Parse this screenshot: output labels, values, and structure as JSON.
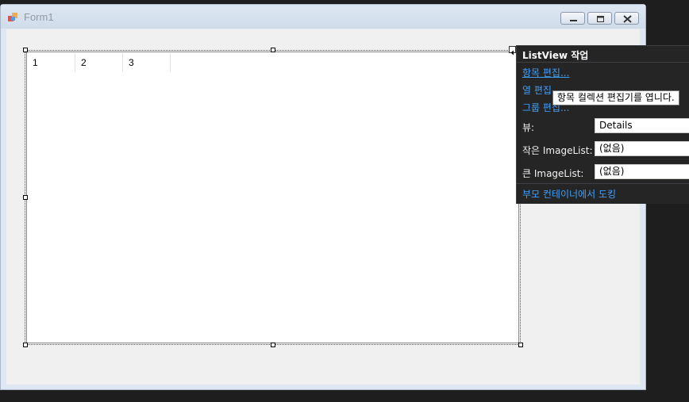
{
  "form": {
    "title": "Form1",
    "caption_buttons": [
      "minimize-icon",
      "maximize-icon",
      "close-icon"
    ]
  },
  "listview": {
    "columns": [
      "1",
      "2",
      "3"
    ]
  },
  "smart_tag": {
    "title": "ListView 작업",
    "links": {
      "edit_items": "항목 편집...",
      "edit_columns": "열 편집...",
      "edit_groups": "그룹 편집...",
      "dock": "부모 컨테이너에서 도킹"
    },
    "props": {
      "view_label": "뷰:",
      "view_value": "Details",
      "small_imagelist_label": "작은 ImageList:",
      "small_imagelist_value": "(없음)",
      "large_imagelist_label": "큰 ImageList:",
      "large_imagelist_value": "(없음)"
    },
    "tooltip": "항목 컬렉션 편집기를 엽니다."
  },
  "colors": {
    "panel_bg": "#252526",
    "link": "#3ea0ff",
    "form_bg": "#f0f0f0"
  }
}
